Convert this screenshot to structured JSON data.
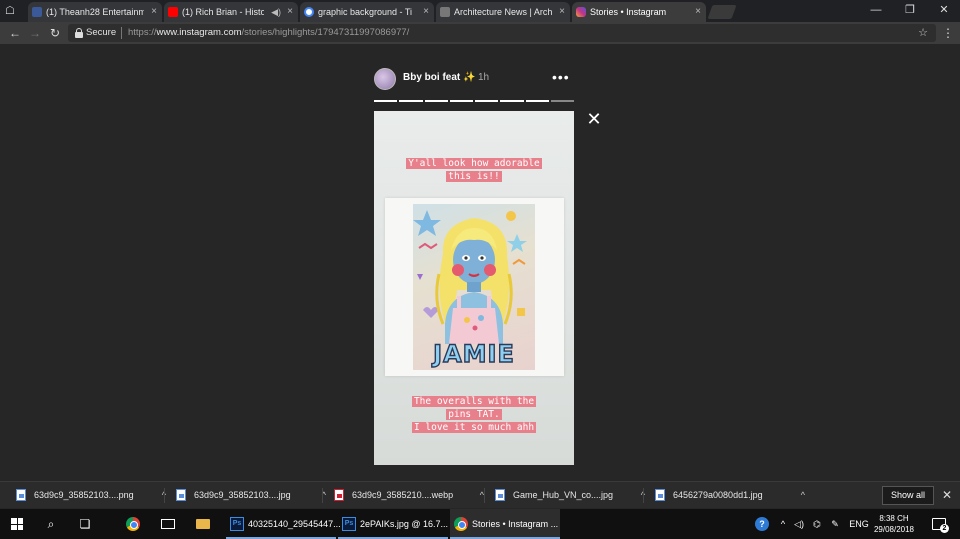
{
  "browser": {
    "tabs": [
      {
        "label": "(1) Theanh28 Entertainm",
        "favicon": "facebook-icon",
        "favicon_color": "#3b5998",
        "active": false
      },
      {
        "label": "(1) Rich Brian - Histo",
        "favicon": "youtube-icon",
        "favicon_color": "#ff0000",
        "active": false,
        "sound": true
      },
      {
        "label": "graphic background - Ti",
        "favicon": "google-icon",
        "favicon_color": "#4285f4",
        "active": false
      },
      {
        "label": "Architecture News | Arch",
        "favicon": "page-icon",
        "favicon_color": "#777777",
        "active": false
      },
      {
        "label": "Stories • Instagram",
        "favicon": "instagram-icon",
        "favicon_color": "#c13584",
        "active": true
      }
    ],
    "close_glyph": "×",
    "window_controls": [
      "—",
      "❐",
      "✕"
    ],
    "address": {
      "secure_label": "Secure",
      "url_prefix": "https://",
      "url_host": "www.instagram.com",
      "url_path": "/stories/highlights/17947311997086977/"
    }
  },
  "story": {
    "username": "Bby boi feat",
    "sparkle": "✨",
    "time_ago": "1h",
    "more_glyph": "•••",
    "close_glyph": "✕",
    "segments_total": 8,
    "segments_viewed": 7,
    "caption_top": [
      "Y'all look how adorable",
      "this is!!"
    ],
    "caption_bottom": [
      "The overalls with the",
      "pins TAT.",
      "I love it so much ahh"
    ],
    "artwork_text": "JAMIE",
    "accent_color": "#e8808c"
  },
  "downloads": {
    "items": [
      {
        "name": "63d9c9_35852103....png",
        "type": "image"
      },
      {
        "name": "63d9c9_35852103....jpg",
        "type": "image"
      },
      {
        "name": "63d9c9_3585210....webp",
        "type": "webp"
      },
      {
        "name": "Game_Hub_VN_co....jpg",
        "type": "image"
      },
      {
        "name": "6456279a0080dd1.jpg",
        "type": "image"
      }
    ],
    "caret": "^",
    "show_all_label": "Show all",
    "close_glyph": "✕"
  },
  "taskbar": {
    "apps": [
      {
        "label": "40325140_29545447...",
        "icon": "photoshop-icon",
        "icon_text": "Ps",
        "active": false
      },
      {
        "label": "2ePAIKs.jpg @ 16.7...",
        "icon": "photoshop-icon",
        "icon_text": "Ps",
        "active": false
      },
      {
        "label": "Stories • Instagram ...",
        "icon": "chrome-icon",
        "active": true
      }
    ],
    "help_glyph": "?",
    "language": "ENG",
    "time": "8:38 CH",
    "date": "29/08/2018",
    "notification_count": "2"
  }
}
